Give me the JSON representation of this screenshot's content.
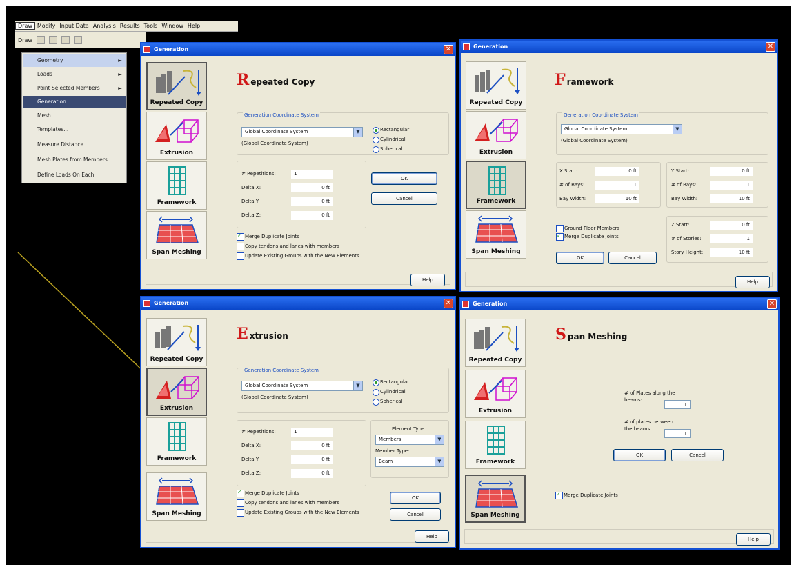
{
  "menubar": {
    "items": [
      "Draw",
      "Modify",
      "Input Data",
      "Analysis",
      "Results",
      "Tools",
      "Window",
      "Help"
    ]
  },
  "toolbar": {
    "draw_label": "Draw"
  },
  "menu": {
    "items": [
      {
        "label": "Geometry",
        "arrow": "►"
      },
      {
        "label": "Loads",
        "arrow": "►"
      },
      {
        "label": "Point Selected Members",
        "arrow": "►"
      },
      {
        "label": "Generation..."
      },
      {
        "label": "Mesh..."
      },
      {
        "label": "Templates..."
      },
      {
        "label": "Measure Distance"
      },
      {
        "label": "Mesh Plates from Members"
      },
      {
        "label": "Define Loads On Each"
      }
    ]
  },
  "common": {
    "window_title": "Generation",
    "close_glyph": "✕",
    "dd_glyph": "▼",
    "side_buttons": [
      "Repeated Copy",
      "Extrusion",
      "Framework",
      "Span Meshing"
    ],
    "gcs_group": "Generation Coordinate System",
    "gcs_value": "Global Coordinate System",
    "gcs_sub": "(Global Coordinate System)",
    "radios": [
      "Rectangular",
      "Cylindrical",
      "Spherical"
    ],
    "ok": "OK",
    "cancel": "Cancel",
    "help": "Help",
    "merge": "Merge Duplicate Joints",
    "copy_tendons": "Copy tendons and lanes with members",
    "update_groups": "Update Existing Groups with the New Elements"
  },
  "repeated": {
    "title_cap": "R",
    "title_rest": "epeated Copy",
    "repetitions_label": "# Repetitions:",
    "repetitions_value": "1",
    "delta_x_label": "Delta X:",
    "delta_x_value": "0 ft",
    "delta_y_label": "Delta Y:",
    "delta_y_value": "0 ft",
    "delta_z_label": "Delta Z:",
    "delta_z_value": "0 ft"
  },
  "framework": {
    "title_cap": "F",
    "title_rest": "ramework",
    "x_start_label": "X Start:",
    "x_start_value": "0 ft",
    "x_bays_label": "# of Bays:",
    "x_bays_value": "1",
    "x_bay_width_label": "Bay Width:",
    "x_bay_width_value": "10 ft",
    "y_start_label": "Y Start:",
    "y_start_value": "0 ft",
    "y_bays_label": "# of Bays:",
    "y_bays_value": "1",
    "y_bay_width_label": "Bay Width:",
    "y_bay_width_value": "10 ft",
    "z_start_label": "Z Start:",
    "z_start_value": "0 ft",
    "stories_label": "# of Stories:",
    "stories_value": "1",
    "story_height_label": "Story Height:",
    "story_height_value": "10 ft",
    "ground_floor": "Ground Floor Members"
  },
  "extrusion": {
    "title_cap": "E",
    "title_rest": "xtrusion",
    "repetitions_label": "# Repetitions:",
    "repetitions_value": "1",
    "delta_x_label": "Delta X:",
    "delta_x_value": "0 ft",
    "delta_y_label": "Delta Y:",
    "delta_y_value": "0 ft",
    "delta_z_label": "Delta Z:",
    "delta_z_value": "0 ft",
    "element_type_label": "Element Type",
    "element_type_value": "Members",
    "member_type_label": "Member Type:",
    "member_type_value": "Beam"
  },
  "span": {
    "title_cap": "S",
    "title_rest": "pan Meshing",
    "plates_along_label_1": "# of Plates along the",
    "plates_along_label_2": "beams:",
    "plates_along_value": "1",
    "plates_between_label_1": "# of plates between",
    "plates_between_label_2": "the beams:",
    "plates_between_value": "1"
  }
}
